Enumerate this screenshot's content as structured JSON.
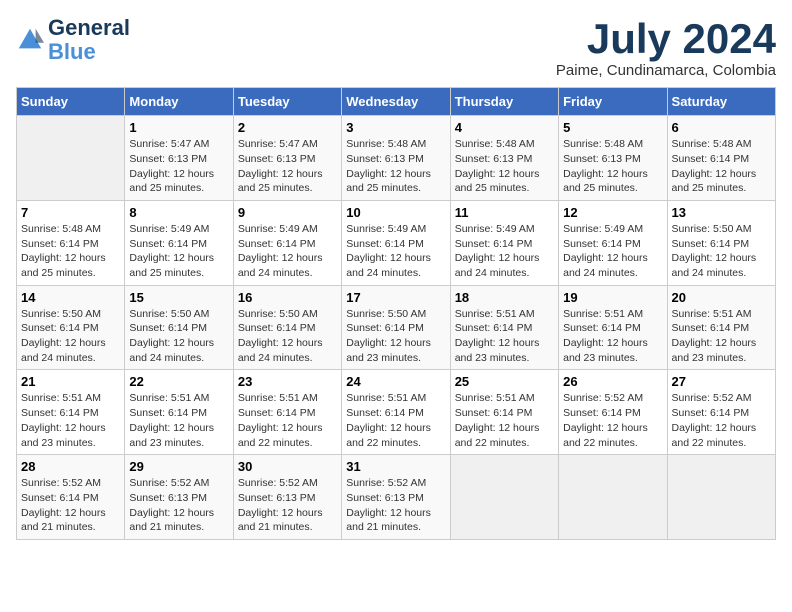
{
  "header": {
    "logo_line1": "General",
    "logo_line2": "Blue",
    "month": "July 2024",
    "location": "Paime, Cundinamarca, Colombia"
  },
  "weekdays": [
    "Sunday",
    "Monday",
    "Tuesday",
    "Wednesday",
    "Thursday",
    "Friday",
    "Saturday"
  ],
  "weeks": [
    [
      {
        "day": "",
        "sunrise": "",
        "sunset": "",
        "daylight": ""
      },
      {
        "day": "1",
        "sunrise": "Sunrise: 5:47 AM",
        "sunset": "Sunset: 6:13 PM",
        "daylight": "Daylight: 12 hours and 25 minutes."
      },
      {
        "day": "2",
        "sunrise": "Sunrise: 5:47 AM",
        "sunset": "Sunset: 6:13 PM",
        "daylight": "Daylight: 12 hours and 25 minutes."
      },
      {
        "day": "3",
        "sunrise": "Sunrise: 5:48 AM",
        "sunset": "Sunset: 6:13 PM",
        "daylight": "Daylight: 12 hours and 25 minutes."
      },
      {
        "day": "4",
        "sunrise": "Sunrise: 5:48 AM",
        "sunset": "Sunset: 6:13 PM",
        "daylight": "Daylight: 12 hours and 25 minutes."
      },
      {
        "day": "5",
        "sunrise": "Sunrise: 5:48 AM",
        "sunset": "Sunset: 6:13 PM",
        "daylight": "Daylight: 12 hours and 25 minutes."
      },
      {
        "day": "6",
        "sunrise": "Sunrise: 5:48 AM",
        "sunset": "Sunset: 6:14 PM",
        "daylight": "Daylight: 12 hours and 25 minutes."
      }
    ],
    [
      {
        "day": "7",
        "sunrise": "Sunrise: 5:48 AM",
        "sunset": "Sunset: 6:14 PM",
        "daylight": "Daylight: 12 hours and 25 minutes."
      },
      {
        "day": "8",
        "sunrise": "Sunrise: 5:49 AM",
        "sunset": "Sunset: 6:14 PM",
        "daylight": "Daylight: 12 hours and 25 minutes."
      },
      {
        "day": "9",
        "sunrise": "Sunrise: 5:49 AM",
        "sunset": "Sunset: 6:14 PM",
        "daylight": "Daylight: 12 hours and 24 minutes."
      },
      {
        "day": "10",
        "sunrise": "Sunrise: 5:49 AM",
        "sunset": "Sunset: 6:14 PM",
        "daylight": "Daylight: 12 hours and 24 minutes."
      },
      {
        "day": "11",
        "sunrise": "Sunrise: 5:49 AM",
        "sunset": "Sunset: 6:14 PM",
        "daylight": "Daylight: 12 hours and 24 minutes."
      },
      {
        "day": "12",
        "sunrise": "Sunrise: 5:49 AM",
        "sunset": "Sunset: 6:14 PM",
        "daylight": "Daylight: 12 hours and 24 minutes."
      },
      {
        "day": "13",
        "sunrise": "Sunrise: 5:50 AM",
        "sunset": "Sunset: 6:14 PM",
        "daylight": "Daylight: 12 hours and 24 minutes."
      }
    ],
    [
      {
        "day": "14",
        "sunrise": "Sunrise: 5:50 AM",
        "sunset": "Sunset: 6:14 PM",
        "daylight": "Daylight: 12 hours and 24 minutes."
      },
      {
        "day": "15",
        "sunrise": "Sunrise: 5:50 AM",
        "sunset": "Sunset: 6:14 PM",
        "daylight": "Daylight: 12 hours and 24 minutes."
      },
      {
        "day": "16",
        "sunrise": "Sunrise: 5:50 AM",
        "sunset": "Sunset: 6:14 PM",
        "daylight": "Daylight: 12 hours and 24 minutes."
      },
      {
        "day": "17",
        "sunrise": "Sunrise: 5:50 AM",
        "sunset": "Sunset: 6:14 PM",
        "daylight": "Daylight: 12 hours and 23 minutes."
      },
      {
        "day": "18",
        "sunrise": "Sunrise: 5:51 AM",
        "sunset": "Sunset: 6:14 PM",
        "daylight": "Daylight: 12 hours and 23 minutes."
      },
      {
        "day": "19",
        "sunrise": "Sunrise: 5:51 AM",
        "sunset": "Sunset: 6:14 PM",
        "daylight": "Daylight: 12 hours and 23 minutes."
      },
      {
        "day": "20",
        "sunrise": "Sunrise: 5:51 AM",
        "sunset": "Sunset: 6:14 PM",
        "daylight": "Daylight: 12 hours and 23 minutes."
      }
    ],
    [
      {
        "day": "21",
        "sunrise": "Sunrise: 5:51 AM",
        "sunset": "Sunset: 6:14 PM",
        "daylight": "Daylight: 12 hours and 23 minutes."
      },
      {
        "day": "22",
        "sunrise": "Sunrise: 5:51 AM",
        "sunset": "Sunset: 6:14 PM",
        "daylight": "Daylight: 12 hours and 23 minutes."
      },
      {
        "day": "23",
        "sunrise": "Sunrise: 5:51 AM",
        "sunset": "Sunset: 6:14 PM",
        "daylight": "Daylight: 12 hours and 22 minutes."
      },
      {
        "day": "24",
        "sunrise": "Sunrise: 5:51 AM",
        "sunset": "Sunset: 6:14 PM",
        "daylight": "Daylight: 12 hours and 22 minutes."
      },
      {
        "day": "25",
        "sunrise": "Sunrise: 5:51 AM",
        "sunset": "Sunset: 6:14 PM",
        "daylight": "Daylight: 12 hours and 22 minutes."
      },
      {
        "day": "26",
        "sunrise": "Sunrise: 5:52 AM",
        "sunset": "Sunset: 6:14 PM",
        "daylight": "Daylight: 12 hours and 22 minutes."
      },
      {
        "day": "27",
        "sunrise": "Sunrise: 5:52 AM",
        "sunset": "Sunset: 6:14 PM",
        "daylight": "Daylight: 12 hours and 22 minutes."
      }
    ],
    [
      {
        "day": "28",
        "sunrise": "Sunrise: 5:52 AM",
        "sunset": "Sunset: 6:14 PM",
        "daylight": "Daylight: 12 hours and 21 minutes."
      },
      {
        "day": "29",
        "sunrise": "Sunrise: 5:52 AM",
        "sunset": "Sunset: 6:13 PM",
        "daylight": "Daylight: 12 hours and 21 minutes."
      },
      {
        "day": "30",
        "sunrise": "Sunrise: 5:52 AM",
        "sunset": "Sunset: 6:13 PM",
        "daylight": "Daylight: 12 hours and 21 minutes."
      },
      {
        "day": "31",
        "sunrise": "Sunrise: 5:52 AM",
        "sunset": "Sunset: 6:13 PM",
        "daylight": "Daylight: 12 hours and 21 minutes."
      },
      {
        "day": "",
        "sunrise": "",
        "sunset": "",
        "daylight": ""
      },
      {
        "day": "",
        "sunrise": "",
        "sunset": "",
        "daylight": ""
      },
      {
        "day": "",
        "sunrise": "",
        "sunset": "",
        "daylight": ""
      }
    ]
  ]
}
